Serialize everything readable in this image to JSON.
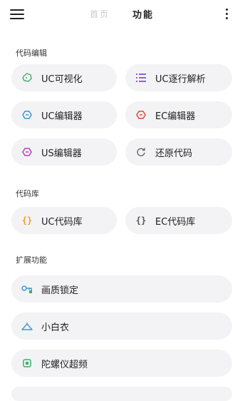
{
  "header": {
    "home_tab": "首页",
    "func_tab": "功能"
  },
  "sections": {
    "code_edit": "代码编辑",
    "code_lib": "代码库",
    "ext": "扩展功能"
  },
  "buttons": {
    "uc_visual": "UC可视化",
    "uc_parse": "UC逐行解析",
    "uc_editor": "UC编辑器",
    "ec_editor": "EC编辑器",
    "us_editor": "US编辑器",
    "restore": "还原代码",
    "uc_lib": "UC代码库",
    "ec_lib": "EC代码库",
    "lock_quality": "画质锁定",
    "xiaobaiyi": "小白衣",
    "gyro": "陀螺仪超频"
  },
  "colors": {
    "green": "#3fae6a",
    "purple": "#8c63d6",
    "blue": "#3a9bd5",
    "red": "#e04a3c",
    "magenta": "#c13fb8",
    "gray": "#666666",
    "orange": "#f0a020",
    "chip_bg": "#f3f3f5"
  }
}
